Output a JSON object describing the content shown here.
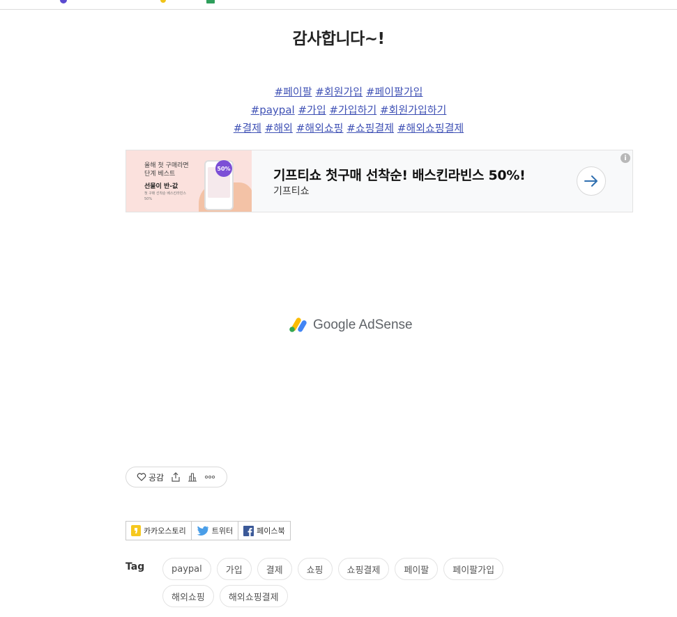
{
  "title": "감사합니다~!",
  "hashtags": {
    "line1": [
      "#페이팔",
      "#회원가입",
      "#페이팔가입"
    ],
    "line2": [
      "#paypal",
      "#가입",
      "#가입하기",
      "#회원가입하기"
    ],
    "line3": [
      "#결제",
      "#해외",
      "#해외쇼핑",
      "#쇼핑결제",
      "#해외쇼핑결제"
    ]
  },
  "ad": {
    "thumb_line1": "올해 첫 구매라면",
    "thumb_line2": "단계 베스트",
    "thumb_bold": "선물이 반-값",
    "thumb_small": "첫 구매 선착순 베스킨라빈스 50%",
    "thumb_badge": "50%",
    "headline": "기프티쇼 첫구매 선착순! 배스킨라빈스 50%!",
    "advertiser": "기프티쇼",
    "info_label": "i"
  },
  "adsense_label": "Google AdSense",
  "reactions": {
    "like_label": "공감"
  },
  "share": [
    {
      "label": "카카오스토리",
      "icon": "kakaostory-icon"
    },
    {
      "label": "트위터",
      "icon": "twitter-icon"
    },
    {
      "label": "페이스북",
      "icon": "facebook-icon"
    }
  ],
  "tags_label": "Tag",
  "tags": [
    "paypal",
    "가입",
    "결제",
    "쇼핑",
    "쇼핑결제",
    "페이팔",
    "페이팔가입",
    "해외쇼핑",
    "해외쇼핑결제"
  ],
  "colors": {
    "link": "#3f51b5",
    "ad_thumb_bg": "#fbe1dd",
    "adsense_yellow": "#fbbc04",
    "adsense_green": "#34a853",
    "adsense_blue": "#4285f4"
  }
}
